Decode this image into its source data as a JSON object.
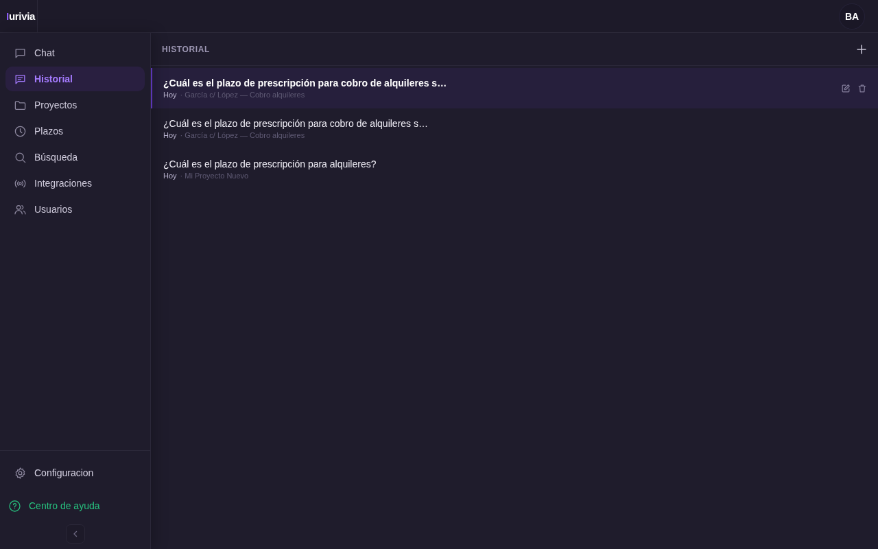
{
  "header": {
    "logo": {
      "accent": "I",
      "text": "urivia"
    },
    "avatar": "BA"
  },
  "sidebar": {
    "items": [
      {
        "label": "Chat",
        "selected": false
      },
      {
        "label": "Historial",
        "selected": true
      },
      {
        "label": "Proyectos",
        "selected": false
      },
      {
        "label": "Plazos",
        "selected": false
      },
      {
        "label": "Búsqueda",
        "selected": false
      },
      {
        "label": "Integraciones",
        "selected": false
      },
      {
        "label": "Usuarios",
        "selected": false
      }
    ],
    "settings": {
      "label": "Configuracion"
    },
    "help": {
      "label": "Centro de ayuda"
    }
  },
  "history": {
    "title": "HISTORIAL",
    "rows": [
      {
        "title": "¿Cuál es el plazo de prescripción para cobro de alquileres s…",
        "date": "Hoy",
        "project": "· García c/ López — Cobro alquileres",
        "selected": true
      },
      {
        "title": "¿Cuál es el plazo de prescripción para cobro de alquileres s…",
        "date": "Hoy",
        "project": "· García c/ López — Cobro alquileres",
        "selected": false
      },
      {
        "title": "¿Cuál es el plazo de prescripción para alquileres?",
        "date": "Hoy",
        "project": "· Mi Proyecto Nuevo",
        "selected": false
      }
    ]
  }
}
